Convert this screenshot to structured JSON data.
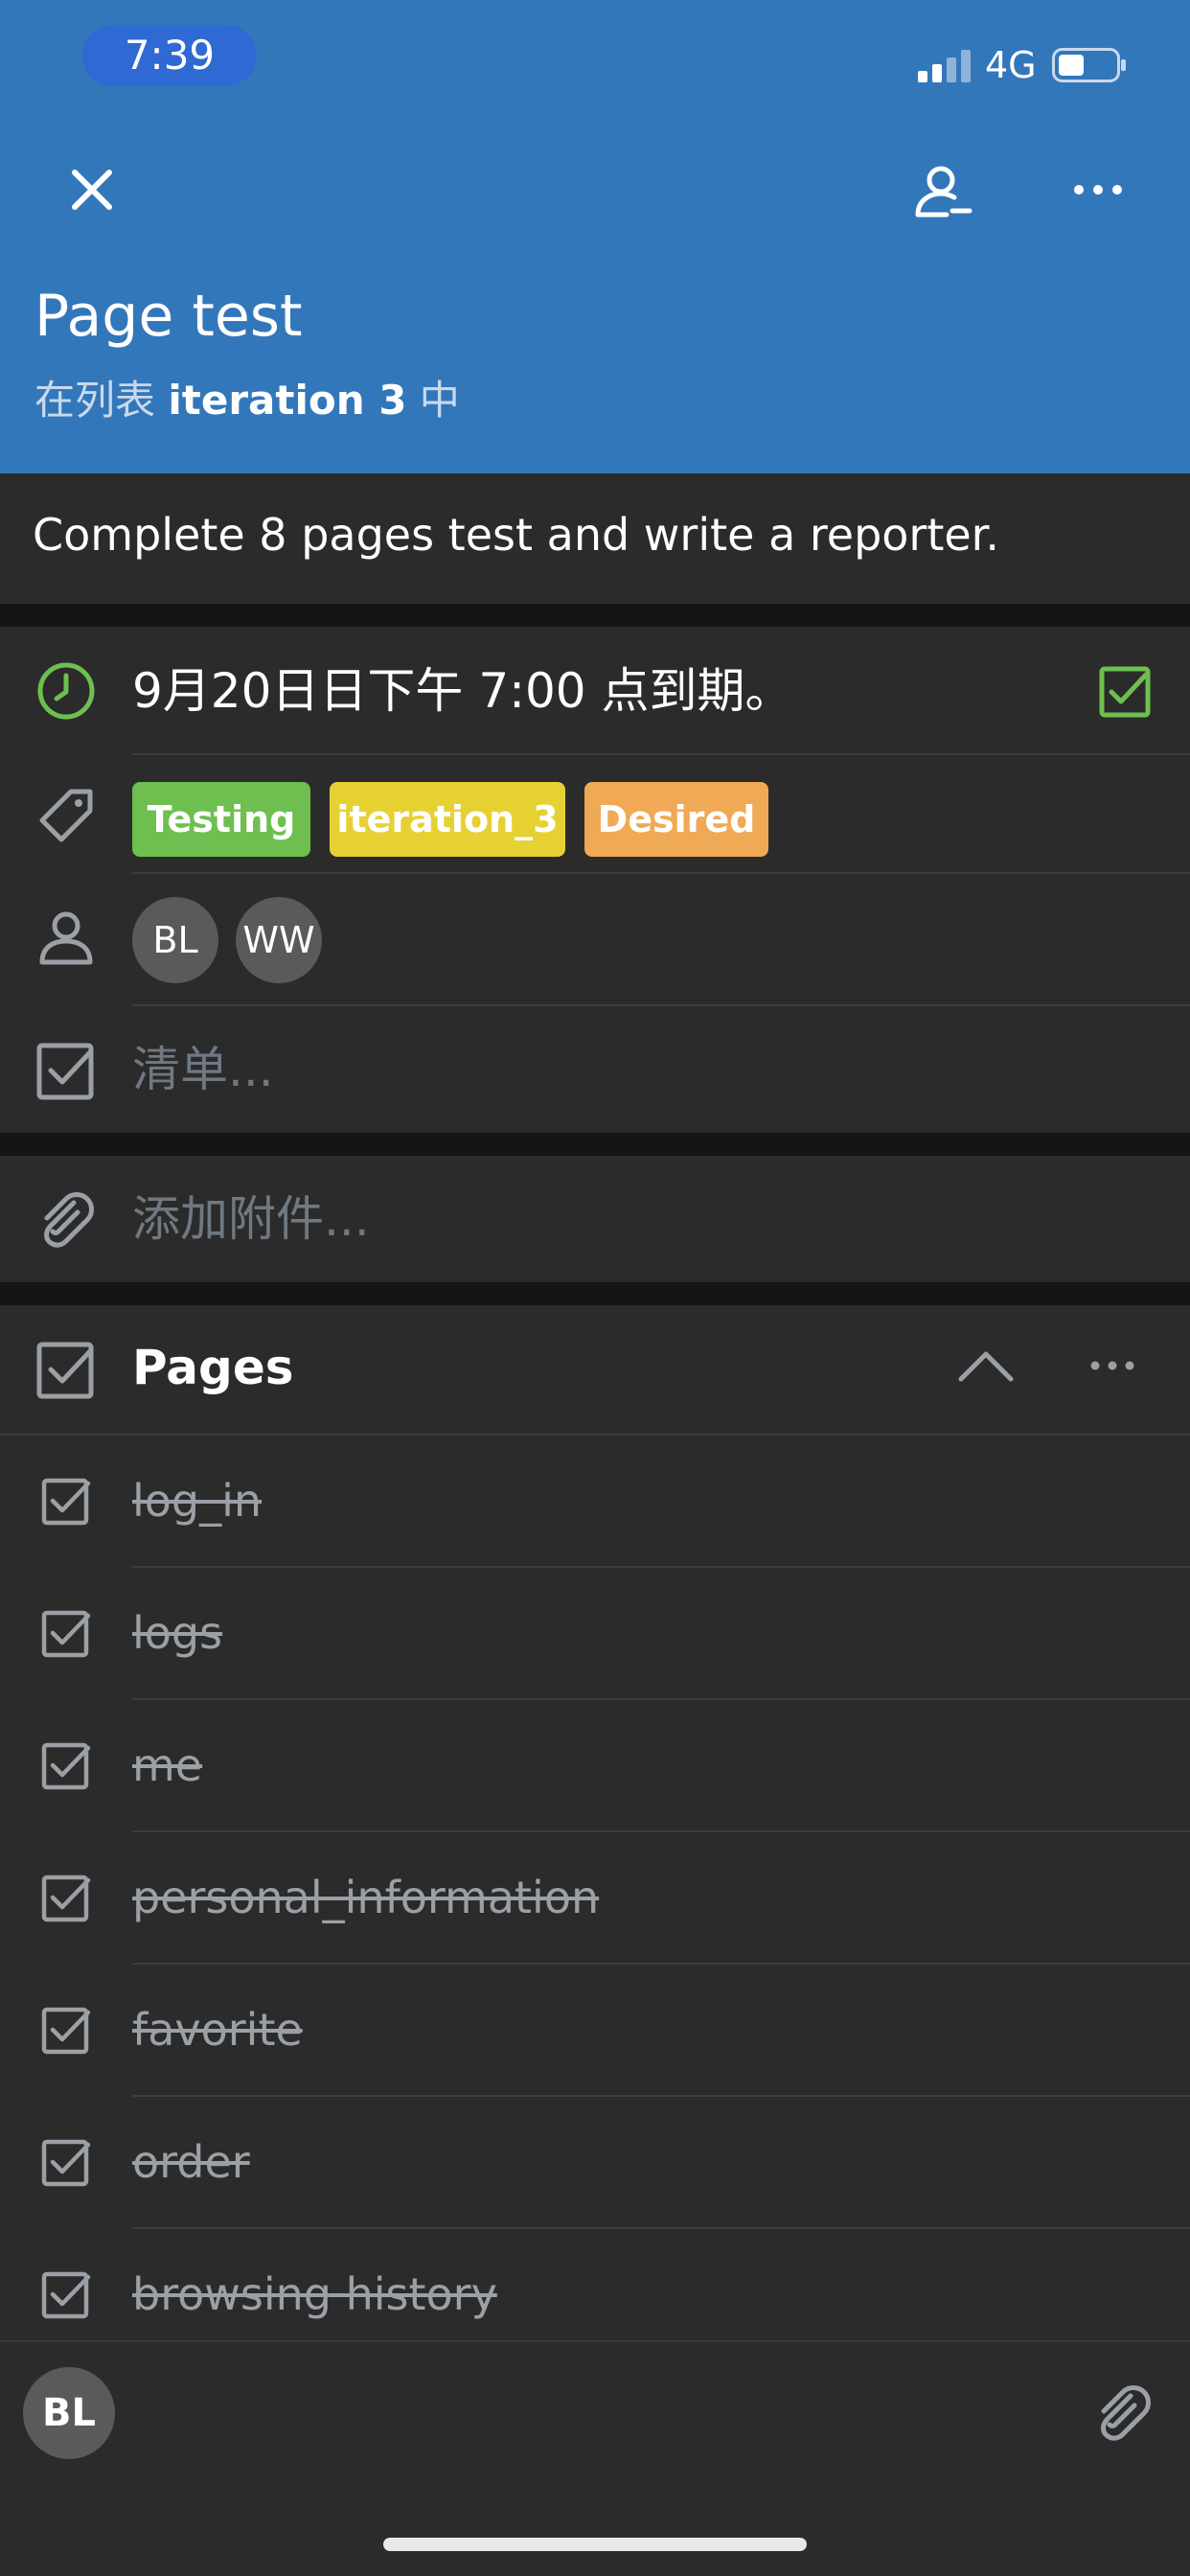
{
  "status_bar": {
    "time": "7:39",
    "network": "4G"
  },
  "header": {
    "title": "Page test",
    "subtitle_prefix": "在列表 ",
    "list_name": "iteration 3",
    "subtitle_suffix": " 中"
  },
  "description": "Complete 8 pages test and write a reporter.",
  "due": {
    "text": "9月20日日下午 7:00 点到期。",
    "completed": true
  },
  "labels": [
    {
      "text": "Testing",
      "color": "#6ebf4f"
    },
    {
      "text": "iteration_3",
      "color": "#e5d232"
    },
    {
      "text": "Desired",
      "color": "#f0a955"
    }
  ],
  "members": [
    "BL",
    "WW"
  ],
  "checklist_placeholder": "清单...",
  "attachment_placeholder": "添加附件...",
  "checklist": {
    "title": "Pages",
    "items": [
      {
        "text": "log_in",
        "checked": true
      },
      {
        "text": "logs",
        "checked": true
      },
      {
        "text": "me",
        "checked": true
      },
      {
        "text": "personal_information",
        "checked": true
      },
      {
        "text": "favorite",
        "checked": true
      },
      {
        "text": "order",
        "checked": true
      },
      {
        "text": "browsing history",
        "checked": true
      }
    ]
  },
  "bottom": {
    "avatar": "BL"
  },
  "colors": {
    "header": "#3377bb",
    "background": "#2b2b2b",
    "due_green": "#6ebf4f"
  }
}
